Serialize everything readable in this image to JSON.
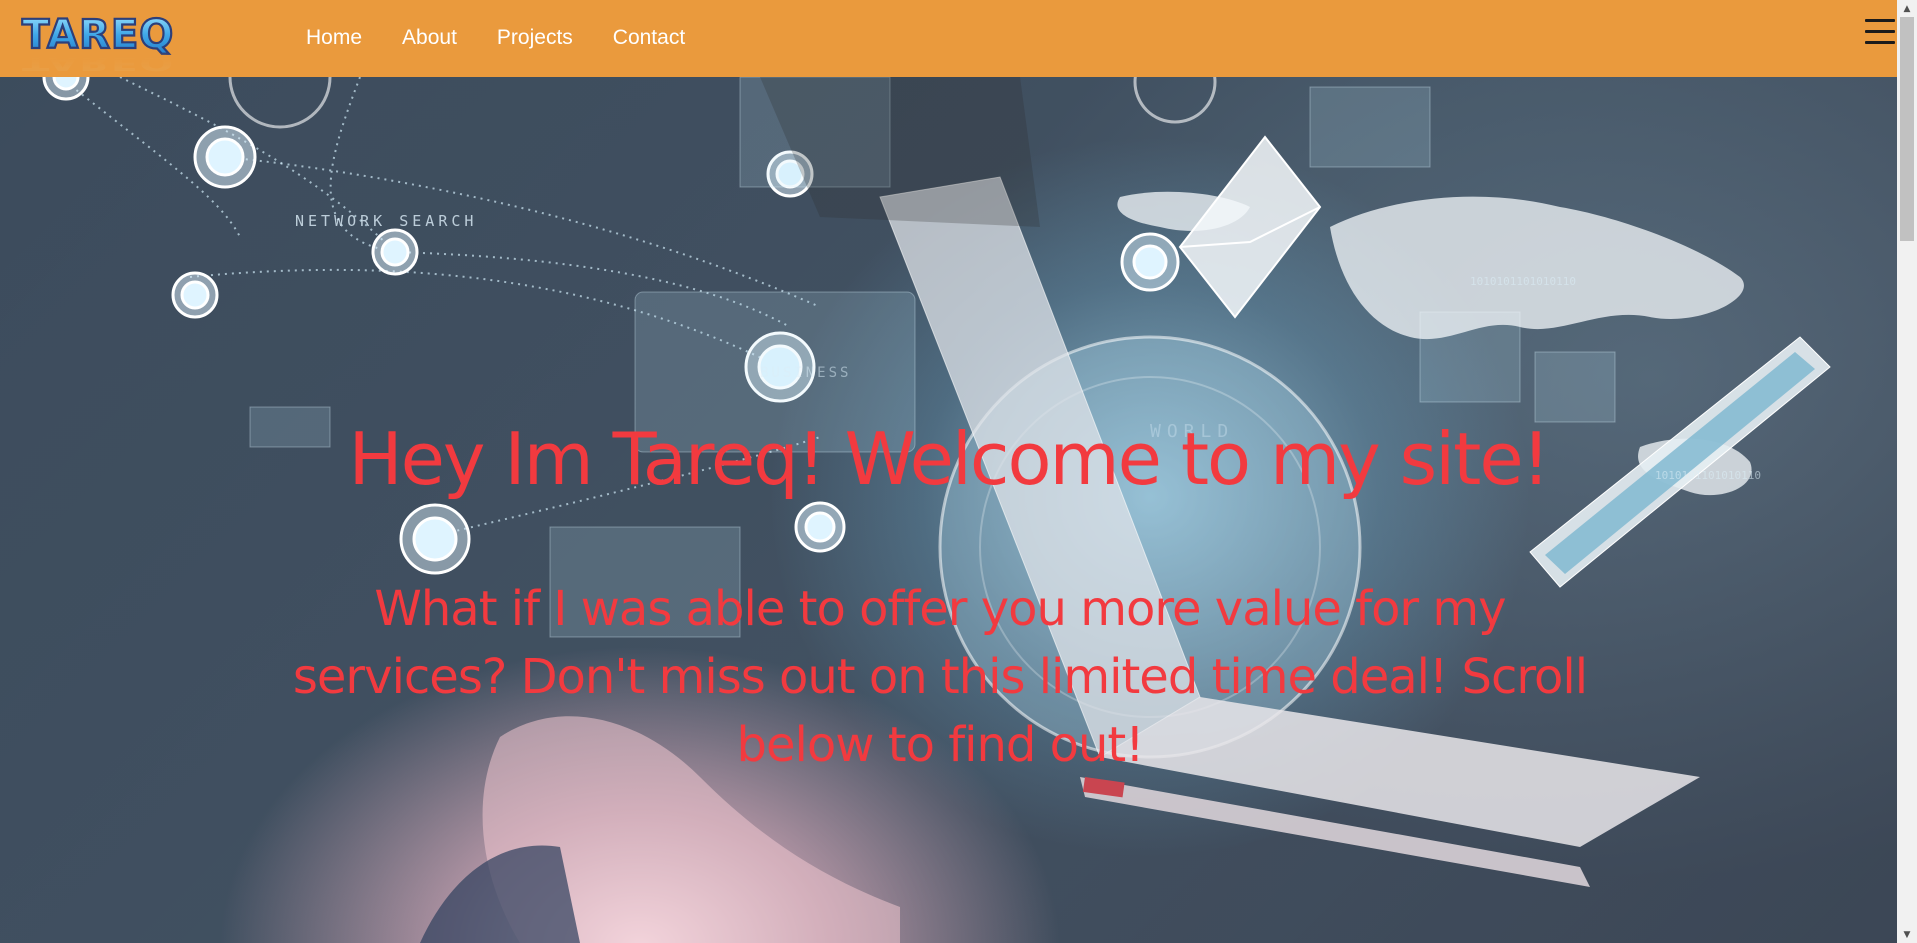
{
  "colors": {
    "nav_bg": "#ea9a3d",
    "hero_text": "#f23a3f",
    "nav_text": "#ffffff"
  },
  "header": {
    "logo_text": "TAREQ",
    "nav": [
      {
        "label": "Home"
      },
      {
        "label": "About"
      },
      {
        "label": "Projects"
      },
      {
        "label": "Contact"
      }
    ],
    "menu_icon": "hamburger-menu-icon"
  },
  "hero": {
    "title": "Hey Im Tareq! Welcome to my site!",
    "subtitle": "What if I was able to offer you more value for my services? Don't miss out on this limited time deal! Scroll below to find out!",
    "background_labels": {
      "network_search": "NETWORK SEARCH",
      "business": "BUSINESS",
      "world": "WORLD",
      "binary_1": "1010101101010110",
      "binary_2": "1010101101010110"
    }
  },
  "scrollbar": {
    "up_icon": "scroll-up-arrow-icon",
    "down_icon": "scroll-down-arrow-icon"
  }
}
